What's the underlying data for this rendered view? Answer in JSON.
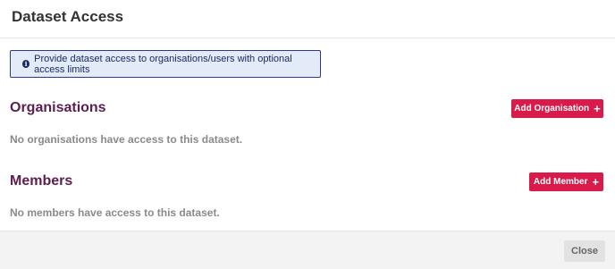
{
  "modal": {
    "title": "Dataset Access"
  },
  "info": {
    "icon": "info-circle-icon",
    "text": "Provide dataset access to organisations/users with optional access limits"
  },
  "organisations": {
    "title": "Organisations",
    "add_label": "Add Organisation",
    "add_icon": "plus-icon",
    "empty_text": "No organisations have access to this dataset."
  },
  "members": {
    "title": "Members",
    "add_label": "Add Member",
    "add_icon": "plus-icon",
    "empty_text": "No members have access to this dataset."
  },
  "footer": {
    "close_label": "Close"
  },
  "colors": {
    "section_title": "#5a1e4f",
    "accent_button": "#d81b4a",
    "info_border": "#2b3a8c",
    "info_background": "#e3eaf8"
  }
}
